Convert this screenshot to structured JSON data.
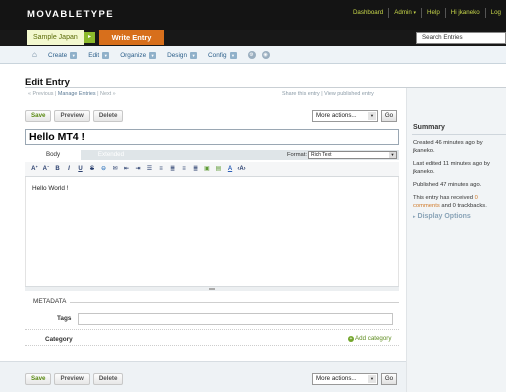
{
  "app": {
    "logo": "MOVABLETYPE",
    "top_links": [
      "Dashboard",
      "Admin",
      "Help",
      "Hi jkaneko",
      "Log"
    ]
  },
  "blog": {
    "name": "Sample Japan",
    "write_button": "Write Entry",
    "search_placeholder": "Search Entries"
  },
  "menu": {
    "items": [
      {
        "label": "Create"
      },
      {
        "label": "Edit"
      },
      {
        "label": "Organize"
      },
      {
        "label": "Design"
      },
      {
        "label": "Config"
      }
    ]
  },
  "page": {
    "title": "Edit Entry",
    "prev": "« Previous",
    "manage": "Manage Entries",
    "next": "Next »",
    "share": "Share this entry",
    "view_published": "View published entry"
  },
  "actions": {
    "save": "Save",
    "preview": "Preview",
    "delete": "Delete",
    "more_actions": "More actions...",
    "go": "Go"
  },
  "entry": {
    "title": "Hello MT4 !",
    "body": "Hello World !"
  },
  "editor": {
    "tab_body": "Body",
    "tab_extended": "Extended",
    "format_label": "Format:",
    "format_value": "Rich Text",
    "toolbar": [
      "A+",
      "A-",
      "B",
      "I",
      "U",
      "S",
      "link",
      "mail",
      "outdent",
      "indent",
      "ul",
      "ol",
      "left",
      "center",
      "right",
      "image",
      "file",
      "A",
      "html"
    ]
  },
  "metadata": {
    "label": "METADATA",
    "tags_label": "Tags",
    "tags_value": "",
    "category_label": "Category",
    "add_category": "Add category"
  },
  "sidebar": {
    "summary_title": "Summary",
    "created": "Created 46 minutes ago by jkaneko.",
    "edited": "Last edited 11 minutes ago by jkaneko.",
    "published": "Published 47 minutes ago.",
    "received_prefix": "This entry has received",
    "comments_link": "0 comments",
    "received_suffix": "and 0 trackbacks.",
    "display_options": "Display Options"
  }
}
